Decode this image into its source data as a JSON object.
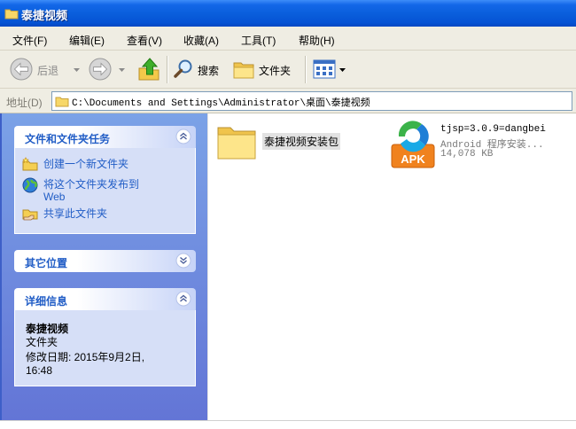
{
  "window": {
    "title": "泰捷视频"
  },
  "menu": [
    {
      "label": "文件(F)"
    },
    {
      "label": "编辑(E)"
    },
    {
      "label": "查看(V)"
    },
    {
      "label": "收藏(A)"
    },
    {
      "label": "工具(T)"
    },
    {
      "label": "帮助(H)"
    }
  ],
  "toolbar": {
    "back_label": "后退",
    "search_label": "搜索",
    "folders_label": "文件夹",
    "icons": [
      "back-icon",
      "forward-icon",
      "up-folder-icon",
      "search-icon",
      "folders-icon",
      "views-icon"
    ]
  },
  "address": {
    "label": "地址(D)",
    "path": "C:\\Documents and Settings\\Administrator\\桌面\\泰捷视频"
  },
  "tasks_panel": {
    "title": "文件和文件夹任务",
    "items": [
      {
        "label": "创建一个新文件夹",
        "icon": "new-folder-icon"
      },
      {
        "label": "将这个文件夹发布到 Web",
        "icon": "globe-icon"
      },
      {
        "label": "共享此文件夹",
        "icon": "share-folder-icon"
      }
    ]
  },
  "other_places_panel": {
    "title": "其它位置"
  },
  "details_panel": {
    "title": "详细信息",
    "name": "泰捷视频",
    "type": "文件夹",
    "modified": "修改日期: 2015年9月2日, 16:48"
  },
  "files": [
    {
      "name": "泰捷视频安装包",
      "icon": "folder-icon",
      "selected": true
    },
    {
      "name": "tjsp=3.0.9=dangbei",
      "type": "Android 程序安装...",
      "size": "14,078 KB",
      "icon": "apk-icon",
      "badge": "APK"
    }
  ],
  "colors": {
    "title_bar": "#0a5fdc",
    "pane_top": "#7ba2e7",
    "pane_bottom": "#6375d6",
    "panel_title": "#215dc6",
    "panel_body": "#d6dff7",
    "link": "#215dc6",
    "bar": "#efede3"
  }
}
